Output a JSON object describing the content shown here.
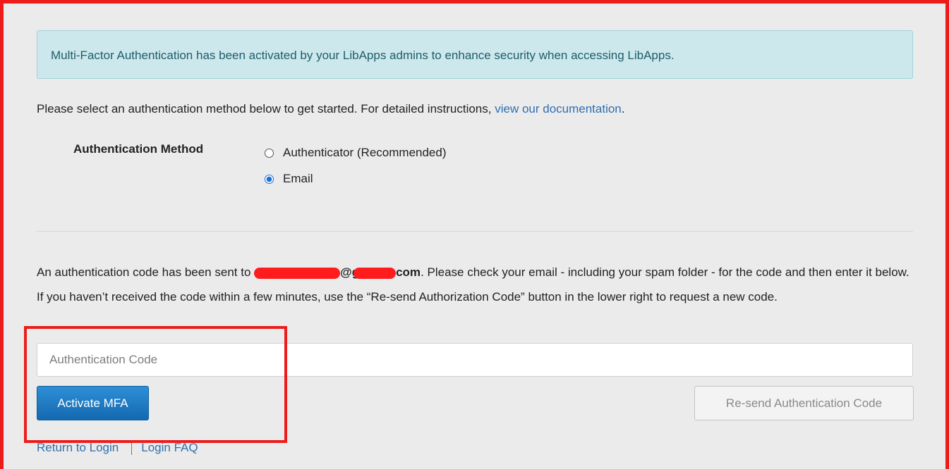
{
  "alert": {
    "text": "Multi-Factor Authentication has been activated by your LibApps admins to enhance security when accessing LibApps."
  },
  "intro": {
    "text": "Please select an authentication method below to get started. For detailed instructions, ",
    "link_label": "view our documentation",
    "end": "."
  },
  "auth_method": {
    "label": "Authentication Method",
    "options": [
      {
        "label": "Authenticator (Recommended)",
        "selected": false
      },
      {
        "label": "Email",
        "selected": true
      }
    ]
  },
  "sent_message": {
    "prefix": "An authentication code has been sent to ",
    "email_at": "@g",
    "email_suffix": "com",
    "rest": ". Please check your email - including your spam folder - for the code and then enter it below. If you haven’t received the code within a few minutes, use the “Re-send Authorization Code” button in the lower right to request a new code."
  },
  "code_input": {
    "placeholder": "Authentication Code",
    "value": ""
  },
  "buttons": {
    "activate_label": "Activate MFA",
    "resend_label": "Re-send Authentication Code"
  },
  "footer": {
    "return_label": "Return to Login",
    "faq_label": "Login FAQ"
  },
  "colors": {
    "annotation_red": "#ee1b1b",
    "primary_blue": "#1a73b8",
    "link_blue": "#2f6fb1",
    "alert_bg": "#cde8ec"
  }
}
